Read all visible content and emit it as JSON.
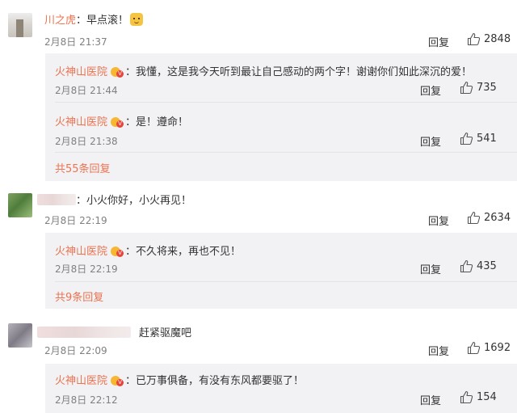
{
  "colors": {
    "username": "#eb7350",
    "text": "#333333",
    "time": "#808080",
    "reply_bg": "#f2f2f5"
  },
  "comments": [
    {
      "username": "川之虎",
      "text": "：早点滚！",
      "emoji": "doge-emoji",
      "time": "2月8日 21:37",
      "reply_label": "回复",
      "likes": "2848",
      "replies": [
        {
          "username": "火神山医院",
          "text": "：我懂，这是我今天听到最让自己感动的两个字！谢谢你们如此深沉的爱！",
          "time": "2月8日 21:44",
          "reply_label": "回复",
          "likes": "735"
        },
        {
          "username": "火神山医院",
          "text": "：是！遵命！",
          "time": "2月8日 21:38",
          "reply_label": "回复",
          "likes": "541"
        }
      ],
      "more_replies": "共55条回复"
    },
    {
      "username": "",
      "text": "：小火你好，小火再见！",
      "time": "2月8日 22:19",
      "reply_label": "回复",
      "likes": "2634",
      "replies": [
        {
          "username": "火神山医院",
          "text": "：不久将来，再也不见！",
          "time": "2月8日 22:19",
          "reply_label": "回复",
          "likes": "435"
        }
      ],
      "more_replies": "共9条回复"
    },
    {
      "username": "",
      "text": "赶紧驱魔吧",
      "time": "2月8日 22:09",
      "reply_label": "回复",
      "likes": "1692",
      "replies": [
        {
          "username": "火神山医院",
          "text": "：已万事俱备，有没有东风都要驱了！",
          "time": "2月8日 22:12",
          "reply_label": "回复",
          "likes": "154"
        }
      ]
    }
  ]
}
